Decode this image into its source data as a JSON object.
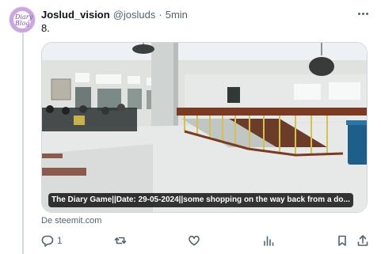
{
  "author": {
    "display_name": "Joslud_vision",
    "handle": "@josluds",
    "separator": "·",
    "time": "5min",
    "avatar_text": "Diary Blog",
    "avatar_colors": {
      "ring": "#d4a6d8",
      "fill": "#c8a6e6"
    }
  },
  "tweet": {
    "text": "8."
  },
  "card": {
    "image_icon": "photo-of-building-interior-with-staircase",
    "caption": "The Diary Game||Date: 29-05-2024||some shopping on the way back from a do...",
    "source": "De steemit.com"
  },
  "actions": {
    "reply": {
      "icon": "reply-icon",
      "count": "1"
    },
    "retweet": {
      "icon": "retweet-icon",
      "count": ""
    },
    "like": {
      "icon": "like-icon",
      "count": ""
    },
    "views": {
      "icon": "views-icon",
      "count": ""
    },
    "bookmark": {
      "icon": "bookmark-icon"
    },
    "share": {
      "icon": "share-icon"
    }
  },
  "colors": {
    "text_primary": "#0f1419",
    "text_secondary": "#536471",
    "border": "#cfd9de"
  }
}
